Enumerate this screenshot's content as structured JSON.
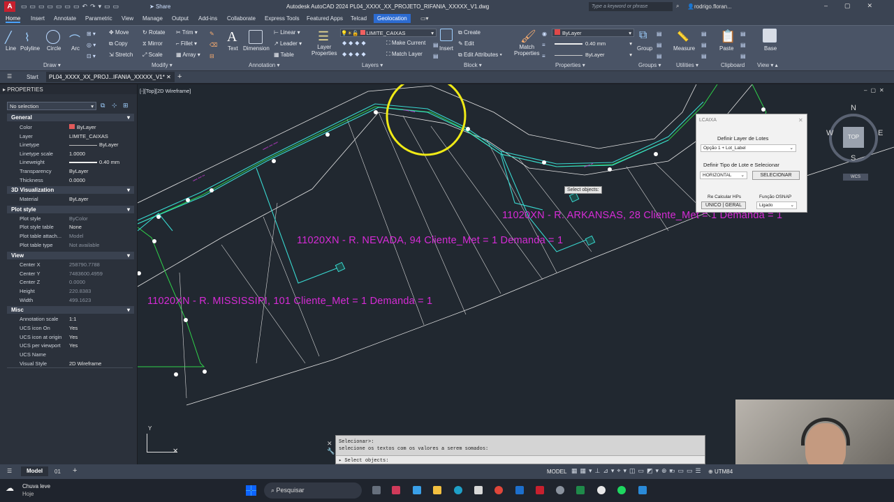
{
  "titlebar": {
    "app_letter": "A",
    "share": "Share",
    "title": "Autodesk AutoCAD 2024   PL04_XXXX_XX_PROJETO_RIFANIA_XXXXX_V1.dwg",
    "search_placeholder": "Type a keyword or phrase",
    "user": "rodrigo.floran..."
  },
  "ribbon_tabs": [
    "Home",
    "Insert",
    "Annotate",
    "Parametric",
    "View",
    "Manage",
    "Output",
    "Add-ins",
    "Collaborate",
    "Express Tools",
    "Featured Apps",
    "Telcad",
    "Geolocation"
  ],
  "ribbon": {
    "draw": {
      "title": "Draw",
      "line": "Line",
      "polyline": "Polyline",
      "circle": "Circle",
      "arc": "Arc"
    },
    "modify": {
      "title": "Modify",
      "move": "Move",
      "rotate": "Rotate",
      "trim": "Trim",
      "copy": "Copy",
      "mirror": "Mirror",
      "fillet": "Fillet",
      "stretch": "Stretch",
      "scale": "Scale",
      "array": "Array"
    },
    "annotation": {
      "title": "Annotation",
      "text": "Text",
      "dimension": "Dimension",
      "linear": "Linear",
      "leader": "Leader",
      "table": "Table"
    },
    "layers": {
      "title": "Layers",
      "layer_properties": "Layer Properties",
      "current_layer": "LIMITE_CAIXAS",
      "make_current": "Make Current",
      "match_layer": "Match Layer"
    },
    "block": {
      "title": "Block",
      "insert": "Insert",
      "create": "Create",
      "edit": "Edit",
      "edit_attributes": "Edit Attributes"
    },
    "properties": {
      "title": "Properties",
      "match": "Match Properties",
      "color": "ByLayer",
      "lineweight": "0.40 mm",
      "linetype": "ByLayer"
    },
    "groups": {
      "title": "Groups",
      "group": "Group"
    },
    "utilities": {
      "title": "Utilities",
      "measure": "Measure"
    },
    "clipboard": {
      "title": "Clipboard",
      "paste": "Paste"
    },
    "view": {
      "title": "View",
      "base": "Base"
    }
  },
  "doc_tabs": {
    "start": "Start",
    "file": "PL04_XXXX_XX_PROJ...IFANIA_XXXXX_V1*"
  },
  "properties_panel": {
    "title": "PROPERTIES",
    "selection": "No selection",
    "sections": {
      "general": "General",
      "visualization": "3D Visualization",
      "plot_style": "Plot style",
      "view": "View",
      "misc": "Misc"
    },
    "general": [
      [
        "Color",
        "ByLayer"
      ],
      [
        "Layer",
        "LIMITE_CAIXAS"
      ],
      [
        "Linetype",
        "ByLayer"
      ],
      [
        "Linetype scale",
        "1.0000"
      ],
      [
        "Lineweight",
        "0.40 mm"
      ],
      [
        "Transparency",
        "ByLayer"
      ],
      [
        "Thickness",
        "0.0000"
      ]
    ],
    "visualization": [
      [
        "Material",
        "ByLayer"
      ]
    ],
    "plot_style": [
      [
        "Plot style",
        "ByColor"
      ],
      [
        "Plot style table",
        "None"
      ],
      [
        "Plot table attach...",
        "Model"
      ],
      [
        "Plot table type",
        "Not available"
      ]
    ],
    "view": [
      [
        "Center X",
        "258790.7788"
      ],
      [
        "Center Y",
        "7483600.4959"
      ],
      [
        "Center Z",
        "0.0000"
      ],
      [
        "Height",
        "220.8383"
      ],
      [
        "Width",
        "499.1623"
      ]
    ],
    "misc": [
      [
        "Annotation scale",
        "1:1"
      ],
      [
        "UCS icon On",
        "Yes"
      ],
      [
        "UCS icon at origin",
        "Yes"
      ],
      [
        "UCS per viewport",
        "Yes"
      ],
      [
        "UCS Name",
        ""
      ],
      [
        "Visual Style",
        "2D Wireframe"
      ]
    ]
  },
  "viewport": {
    "label": "[-][Top][2D Wireframe]",
    "texts": {
      "arkansas": "11020XN - R. ARKANSAS, 28 Cliente_Met = 1  Demanda = 1",
      "nevada": "11020XN - R. NEVADA, 94 Cliente_Met = 1  Demanda = 1",
      "mississipi": "11020XN - R. MISSISSIPI, 101 Cliente_Met = 1  Demanda = 1"
    },
    "tooltip": "Select objects:",
    "viewcube": {
      "n": "N",
      "s": "S",
      "e": "E",
      "w": "W",
      "top": "TOP",
      "wcs": "WCS"
    },
    "ucs_y": "Y"
  },
  "lcaixa": {
    "title": "LCAIXA",
    "define_layer": "Definir Layer de Lotes",
    "layer_option": "Opção 1 + Lot_Label",
    "define_type": "Definir Tipo de Lote e Selecionar",
    "type_value": "HORIZONTAL",
    "select_btn": "SELECIONAR",
    "recalc": "Re Calcular HPs",
    "unico_geral": "UNICO | GERAL",
    "osnap": "Função OSNAP",
    "osnap_value": "Ligado"
  },
  "command": {
    "line1": "Selecionar>:",
    "line2": "selecione os textos com os valores a serem somados:",
    "prompt": "Select objects:"
  },
  "status": {
    "model_tab": "Model",
    "layout_tab": "01",
    "model": "MODEL",
    "coord": "UTM84"
  },
  "taskbar": {
    "weather": "Chuva leve",
    "weather_sub": "Hoje",
    "search": "Pesquisar"
  },
  "colors": {
    "accent": "#2c6bd1",
    "magenta": "#d62bd6",
    "cyan": "#39d8d0",
    "green": "#2fd24a",
    "yellow": "#f0ea16"
  }
}
